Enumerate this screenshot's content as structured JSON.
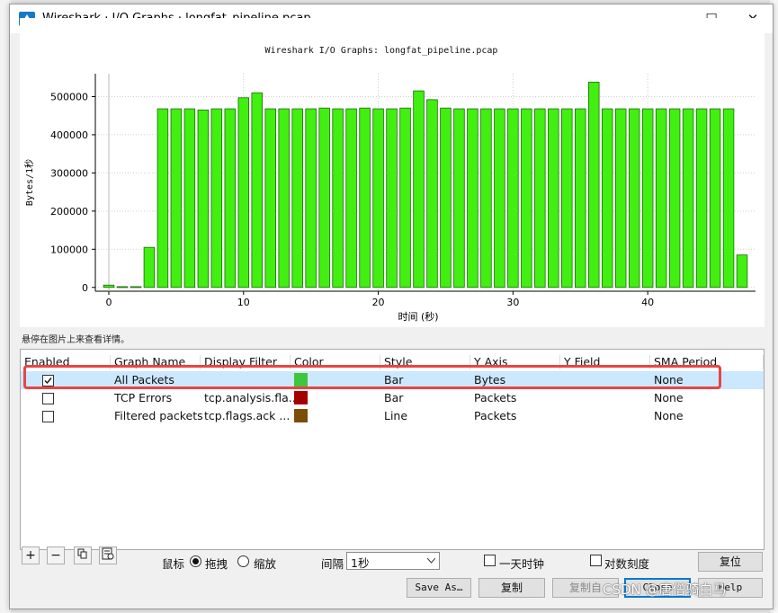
{
  "window": {
    "title": "Wireshark · I/O Graphs · longfat_pipeline.pcap",
    "minimize": "—",
    "maximize": "☐",
    "close": "✕"
  },
  "chart_data": {
    "type": "bar",
    "title": "Wireshark I/O Graphs: longfat_pipeline.pcap",
    "xlabel": "时间 (秒)",
    "ylabel": "Bytes/1秒",
    "xlim": [
      -1,
      48
    ],
    "ylim": [
      -10000,
      560000
    ],
    "xticks": [
      0,
      10,
      20,
      30,
      40
    ],
    "yticks": [
      0,
      100000,
      200000,
      300000,
      400000,
      500000
    ],
    "grid": true,
    "bar_color": "#41ef11",
    "series": [
      {
        "name": "All Packets",
        "x": [
          0,
          1,
          2,
          3,
          4,
          5,
          6,
          7,
          8,
          9,
          10,
          11,
          12,
          13,
          14,
          15,
          16,
          17,
          18,
          19,
          20,
          21,
          22,
          23,
          24,
          25,
          26,
          27,
          28,
          29,
          30,
          31,
          32,
          33,
          34,
          35,
          36,
          37,
          38,
          39,
          40,
          41,
          42,
          43,
          44,
          45,
          46,
          47
        ],
        "values": [
          6000,
          2000,
          2000,
          105000,
          468000,
          468000,
          468000,
          465000,
          468000,
          468000,
          497000,
          510000,
          468000,
          468000,
          468000,
          468000,
          470000,
          468000,
          468000,
          470000,
          468000,
          468000,
          470000,
          515000,
          492000,
          470000,
          468000,
          468000,
          468000,
          468000,
          468000,
          468000,
          468000,
          468000,
          468000,
          468000,
          538000,
          468000,
          468000,
          468000,
          468000,
          468000,
          468000,
          468000,
          468000,
          468000,
          468000,
          85000
        ]
      }
    ]
  },
  "hint_text": "悬停在图片上来查看详情。",
  "table": {
    "headers": [
      "Enabled",
      "Graph Name",
      "Display Filter",
      "Color",
      "Style",
      "Y Axis",
      "Y Field",
      "SMA Period"
    ],
    "rows": [
      {
        "enabled": true,
        "name": "All Packets",
        "filter": "",
        "color": "#3ec63e",
        "style": "Bar",
        "y_axis": "Bytes",
        "y_field": "",
        "sma": "None"
      },
      {
        "enabled": false,
        "name": "TCP Errors",
        "filter": "tcp.analysis.fla...",
        "color": "#a30000",
        "style": "Bar",
        "y_axis": "Packets",
        "y_field": "",
        "sma": "None"
      },
      {
        "enabled": false,
        "name": "Filtered packets",
        "filter": "tcp.flags.ack ...",
        "color": "#7a4e09",
        "style": "Line",
        "y_axis": "Packets",
        "y_field": "",
        "sma": "None"
      }
    ]
  },
  "toolbar": {
    "add": "+",
    "remove": "−",
    "copy_icon": "copy-icon",
    "clear_icon": "clear-icon",
    "mouse_label": "鼠标",
    "drag_label": "拖拽",
    "zoom_label": "缩放",
    "interval_label": "间隔",
    "interval_value": "1秒",
    "time_of_day_label": "一天时钟",
    "log_scale_label": "对数刻度",
    "reset_label": "复位"
  },
  "buttons": {
    "save_as": "Save As…",
    "copy": "复制",
    "copy_from": "复制自",
    "close": "Close",
    "help": "Help"
  },
  "watermark": "CSDN @唐僧骑白马"
}
